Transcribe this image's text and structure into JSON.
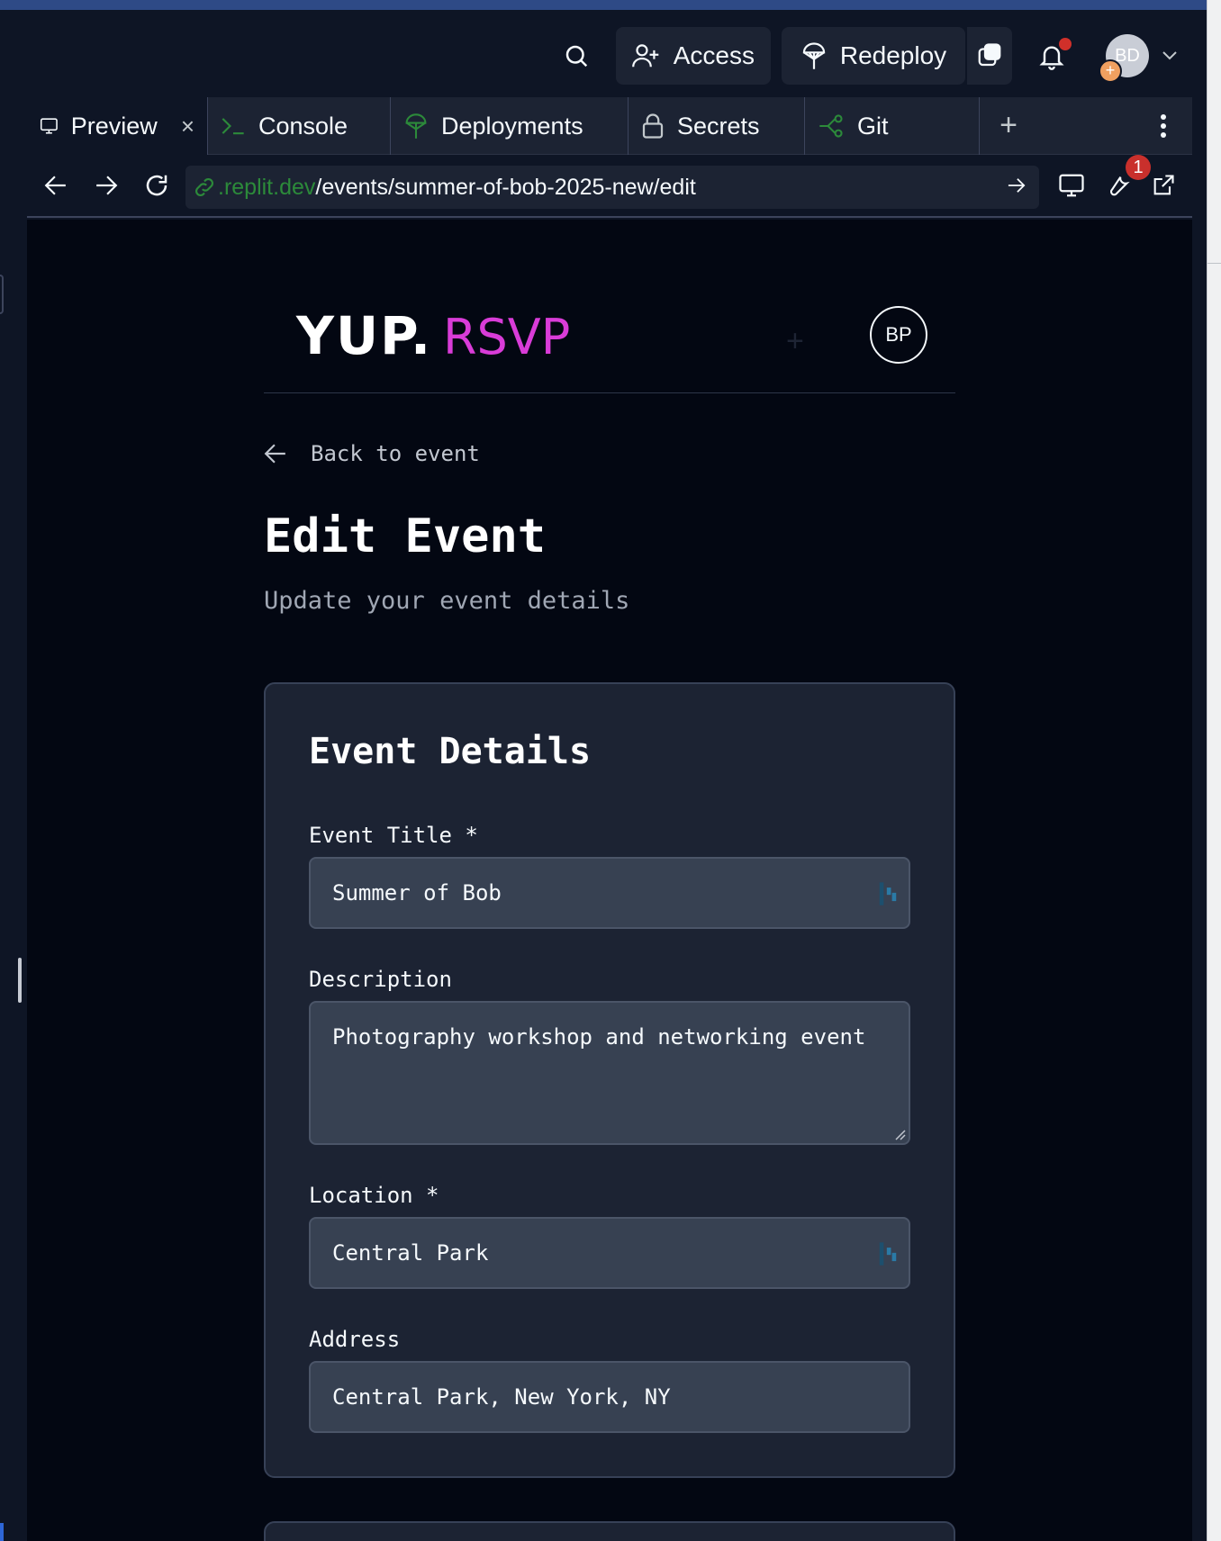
{
  "toolbar": {
    "access_label": "Access",
    "redeploy_label": "Redeploy",
    "user_initials": "BD"
  },
  "tabs": [
    {
      "label": "Preview",
      "icon": "monitor-icon"
    },
    {
      "label": "Console",
      "icon": "terminal-icon"
    },
    {
      "label": "Deployments",
      "icon": "deploy-icon"
    },
    {
      "label": "Secrets",
      "icon": "lock-icon"
    },
    {
      "label": "Git",
      "icon": "git-branch-icon"
    }
  ],
  "url": {
    "host": ".replit.dev",
    "path": "/events/summer-of-bob-2025-new/edit"
  },
  "devtools_badge": "1",
  "app": {
    "logo_main": "YUP.",
    "logo_accent": "RSVP",
    "avatar_initials": "BP",
    "back_label": "Back to event",
    "title": "Edit Event",
    "subtitle": "Update your event details",
    "card_title": "Event Details",
    "fields": {
      "title_label": "Event Title *",
      "title_value": "Summer of Bob",
      "description_label": "Description",
      "description_value": "Photography workshop and networking event",
      "location_label": "Location *",
      "location_value": "Central Park",
      "address_label": "Address",
      "address_value": "Central Park, New York, NY"
    }
  },
  "colors": {
    "accent_magenta": "#d93cd8",
    "url_host_green": "#2c8a3a",
    "badge_red": "#c9302c"
  }
}
